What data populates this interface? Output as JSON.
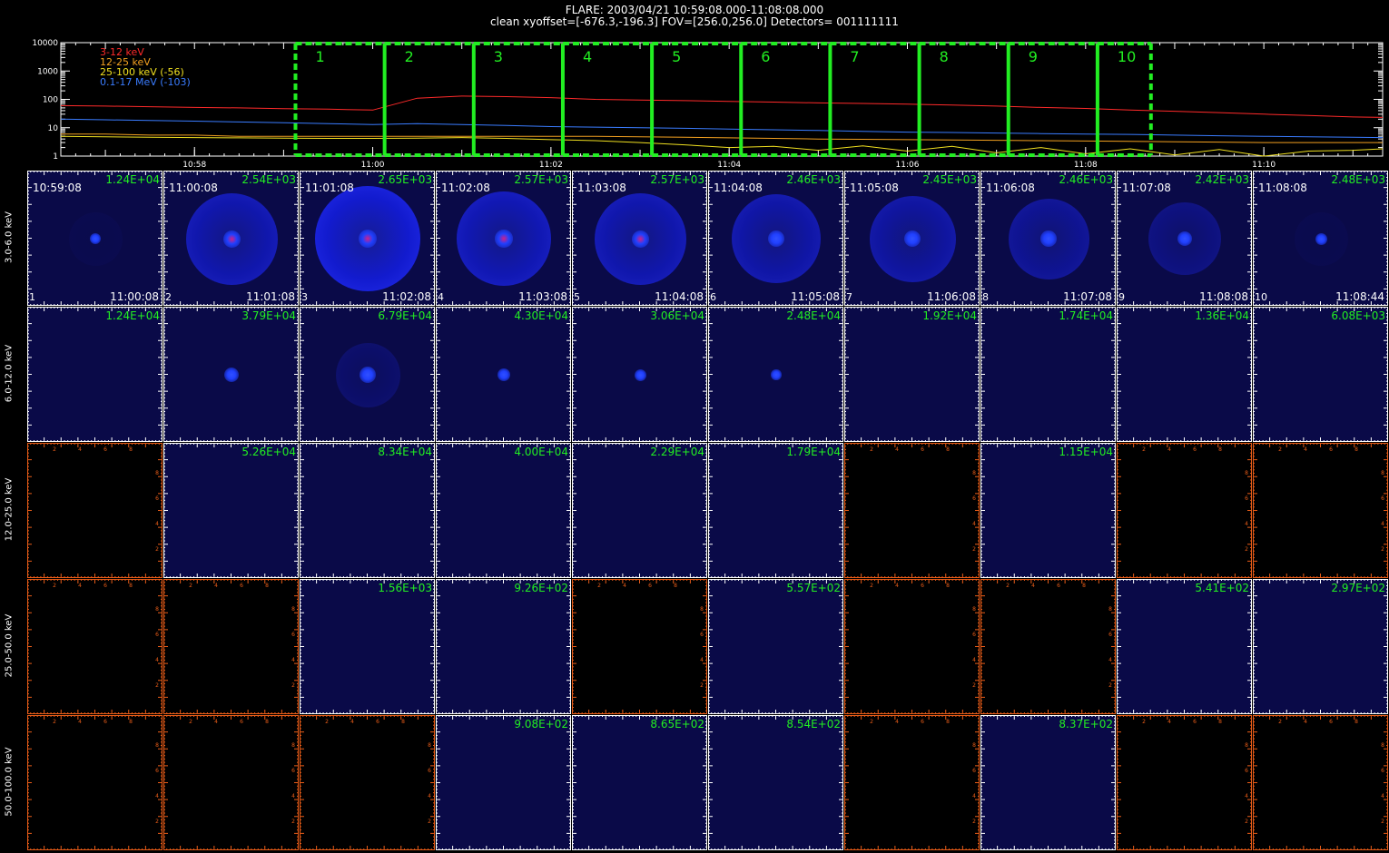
{
  "header": {
    "line1": "FLARE: 2003/04/21 10:59:08.000-11:08:08.000",
    "line2": "clean    xyoffset=[-676.3,-196.3]    FOV=[256.0,256.0]    Detectors= 001111111"
  },
  "colors": {
    "background": "#000000",
    "lc_3_12": "#ff2a2a",
    "lc_12_25": "#f2a020",
    "lc_25_100": "#f0e020",
    "lc_01_17": "#3a7cff",
    "interval_box": "#22ee22",
    "peak_text": "#22ee22",
    "image_bg": "#0a0a48",
    "axis_orange": "#e85c18",
    "axis_white": "#ffffff"
  },
  "chart_data": [
    {
      "type": "line",
      "title": "",
      "xlabel": "",
      "ylabel": "",
      "y_scale": "log",
      "ylim": [
        1,
        10000
      ],
      "y_ticks": [
        "10000",
        "1000",
        "100",
        "10",
        "1"
      ],
      "xlim": [
        "10:56:30",
        "11:11:20"
      ],
      "x_ticks": [
        "10:58",
        "11:00",
        "11:02",
        "11:04",
        "11:06",
        "11:08",
        "11:10"
      ],
      "legend": [
        "3-12 keV",
        "12-25 keV",
        "25-100 keV (-56)",
        "0.1-17 MeV (-103)"
      ],
      "legend_placement": "top-left",
      "x": [
        "10:56:30",
        "10:57:00",
        "10:57:30",
        "10:58:00",
        "10:58:30",
        "10:59:00",
        "10:59:30",
        "11:00:00",
        "11:00:30",
        "11:01:00",
        "11:01:30",
        "11:02:00",
        "11:02:30",
        "11:03:00",
        "11:03:30",
        "11:04:00",
        "11:04:30",
        "11:05:00",
        "11:05:30",
        "11:06:00",
        "11:06:30",
        "11:07:00",
        "11:07:30",
        "11:08:00",
        "11:08:30",
        "11:09:00",
        "11:09:30",
        "11:10:00",
        "11:10:30",
        "11:11:00",
        "11:11:20"
      ],
      "series": [
        {
          "name": "3-12 keV",
          "color": "#ff2a2a",
          "values": [
            60,
            58,
            55,
            52,
            50,
            47,
            45,
            42,
            110,
            130,
            125,
            115,
            100,
            95,
            90,
            85,
            80,
            75,
            72,
            68,
            63,
            58,
            52,
            48,
            42,
            38,
            34,
            30,
            27,
            24,
            23
          ]
        },
        {
          "name": "12-25 keV",
          "color": "#f2a020",
          "values": [
            6,
            6,
            5.5,
            5.5,
            5,
            5,
            5,
            5,
            5,
            5,
            5,
            5,
            5,
            4.8,
            4.6,
            4.4,
            4.2,
            4,
            3.9,
            3.8,
            3.7,
            3.6,
            3.5,
            3.4,
            3.3,
            3.2,
            3.1,
            3,
            3,
            3,
            3
          ]
        },
        {
          "name": "25-100 keV (-56)",
          "color": "#f0e020",
          "values": [
            5,
            4.8,
            4.6,
            4.5,
            4.4,
            4.3,
            4.2,
            4.2,
            4.3,
            4.5,
            4.2,
            3.8,
            3.5,
            3,
            2.5,
            2,
            2.2,
            1.6,
            2.3,
            1.5,
            2.2,
            1.3,
            2,
            1.2,
            1.8,
            1.1,
            1.7,
            1,
            1.5,
            1.6,
            1.8
          ]
        },
        {
          "name": "0.1-17 MeV (-103)",
          "color": "#3a7cff",
          "values": [
            20,
            19,
            18,
            17,
            16,
            15,
            14,
            13,
            14,
            13,
            12,
            11,
            10.5,
            10,
            9.5,
            9,
            8.5,
            8,
            7.5,
            7,
            6.8,
            6.5,
            6.2,
            6,
            5.8,
            5.5,
            5.2,
            5,
            4.8,
            4.6,
            4.5
          ]
        }
      ],
      "intervals": [
        {
          "label": "1",
          "start": "10:59:08",
          "end": "11:00:08"
        },
        {
          "label": "2",
          "start": "11:00:08",
          "end": "11:01:08"
        },
        {
          "label": "3",
          "start": "11:01:08",
          "end": "11:02:08"
        },
        {
          "label": "4",
          "start": "11:02:08",
          "end": "11:03:08"
        },
        {
          "label": "5",
          "start": "11:03:08",
          "end": "11:04:08"
        },
        {
          "label": "6",
          "start": "11:04:08",
          "end": "11:05:08"
        },
        {
          "label": "7",
          "start": "11:05:08",
          "end": "11:06:08"
        },
        {
          "label": "8",
          "start": "11:06:08",
          "end": "11:07:08"
        },
        {
          "label": "9",
          "start": "11:07:08",
          "end": "11:08:08"
        },
        {
          "label": "10",
          "start": "11:08:08",
          "end": "11:08:44"
        }
      ]
    },
    {
      "type": "heatmap",
      "title": "",
      "energy_bands": [
        "3.0-6.0 keV",
        "6.0-12.0 keV",
        "12.0-25.0 keV",
        "25.0-50.0 keV",
        "50.0-100.0 keV"
      ],
      "time_starts": [
        "10:59:08",
        "11:00:08",
        "11:01:08",
        "11:02:08",
        "11:03:08",
        "11:04:08",
        "11:05:08",
        "11:06:08",
        "11:07:08",
        "11:08:08"
      ],
      "time_ends": [
        "11:00:08",
        "11:01:08",
        "11:02:08",
        "11:03:08",
        "11:04:08",
        "11:05:08",
        "11:06:08",
        "11:07:08",
        "11:08:08",
        "11:08:44"
      ],
      "panel_indices": [
        "1",
        "2",
        "3",
        "4",
        "5",
        "6",
        "7",
        "8",
        "9",
        "10"
      ],
      "axis_ticks": [
        "2",
        "4",
        "6",
        "8"
      ],
      "peaks": [
        [
          "1.24E+04",
          "2.54E+03",
          "2.65E+03",
          "2.57E+03",
          "2.57E+03",
          "2.46E+03",
          "2.45E+03",
          "2.46E+03",
          "2.42E+03",
          "2.48E+03"
        ],
        [
          "1.24E+04",
          "3.79E+04",
          "6.79E+04",
          "4.30E+04",
          "3.06E+04",
          "2.48E+04",
          "1.92E+04",
          "1.74E+04",
          "1.36E+04",
          "6.08E+03"
        ],
        [
          "",
          "5.26E+04",
          "8.34E+04",
          "4.00E+04",
          "2.29E+04",
          "1.79E+04",
          "",
          "1.15E+04",
          "",
          ""
        ],
        [
          "",
          "",
          "1.56E+03",
          "9.26E+02",
          "",
          "5.57E+02",
          "",
          "",
          "5.41E+02",
          "2.97E+02"
        ],
        [
          "",
          "",
          "",
          "9.08E+02",
          "8.65E+02",
          "8.54E+02",
          "",
          "8.37E+02",
          "",
          ""
        ]
      ],
      "panel_state": [
        [
          "image",
          "image",
          "image",
          "image",
          "image",
          "image",
          "image",
          "image",
          "image",
          "image"
        ],
        [
          "image",
          "image",
          "image",
          "image",
          "image",
          "image",
          "image",
          "image",
          "image",
          "image"
        ],
        [
          "empty",
          "image",
          "image",
          "image",
          "image",
          "image",
          "empty",
          "image",
          "empty",
          "empty"
        ],
        [
          "empty",
          "empty",
          "image",
          "image",
          "empty",
          "image",
          "empty",
          "empty",
          "image",
          "image"
        ],
        [
          "empty",
          "empty",
          "empty",
          "image",
          "image",
          "image",
          "empty",
          "image",
          "empty",
          "empty"
        ]
      ],
      "source_intensity": [
        [
          0.25,
          0.9,
          1.0,
          0.95,
          0.9,
          0.85,
          0.8,
          0.75,
          0.6,
          0.3
        ],
        [
          0.0,
          0.6,
          0.85,
          0.4,
          0.3,
          0.15,
          0.0,
          0.0,
          0.0,
          0.0
        ],
        [
          0,
          0,
          0,
          0,
          0,
          0,
          0,
          0,
          0,
          0
        ],
        [
          0,
          0,
          0,
          0,
          0,
          0,
          0,
          0,
          0,
          0
        ],
        [
          0,
          0,
          0,
          0,
          0,
          0,
          0,
          0,
          0,
          0
        ]
      ],
      "ring_intensity": [
        [
          0.05,
          0.75,
          1.0,
          0.8,
          0.75,
          0.7,
          0.65,
          0.55,
          0.4,
          0.05
        ],
        [
          0.0,
          0.0,
          0.25,
          0.0,
          0.0,
          0.0,
          0.0,
          0.0,
          0.0,
          0.0
        ],
        [
          0,
          0,
          0,
          0,
          0,
          0,
          0,
          0,
          0,
          0
        ],
        [
          0,
          0,
          0,
          0,
          0,
          0,
          0,
          0,
          0,
          0
        ],
        [
          0,
          0,
          0,
          0,
          0,
          0,
          0,
          0,
          0,
          0
        ]
      ]
    }
  ]
}
